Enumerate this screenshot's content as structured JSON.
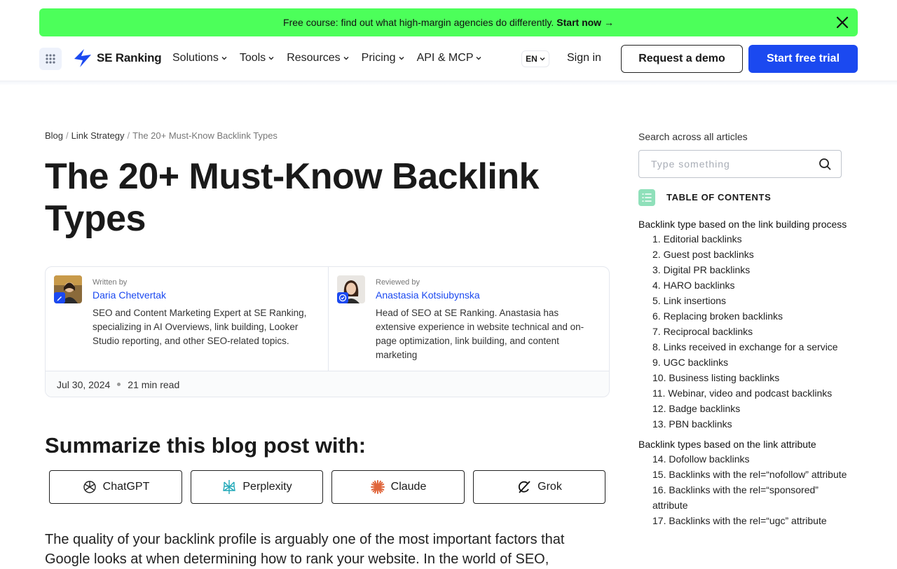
{
  "banner": {
    "text": "Free course: find out what high-margin agencies do differently.",
    "cta": "Start now →"
  },
  "nav": {
    "logo": "SE Ranking",
    "menu": [
      "Solutions",
      "Tools",
      "Resources",
      "Pricing",
      "API & MCP"
    ],
    "lang": "EN",
    "signin": "Sign in",
    "demo": "Request a demo",
    "trial": "Start free trial"
  },
  "breadcrumb": {
    "items": [
      "Blog",
      "Link Strategy"
    ],
    "current": "The 20+ Must-Know Backlink Types"
  },
  "title": "The 20+ Must-Know Backlink Types",
  "authors": [
    {
      "role": "Written by",
      "name": "Daria Chetvertak",
      "bio": "SEO and Content Marketing Expert at SE Ranking, specializing in AI Overviews, link building, Looker Studio reporting, and other SEO-related topics."
    },
    {
      "role": "Reviewed by",
      "name": "Anastasia Kotsiubynska",
      "bio": "Head of SEO at SE Ranking. Anastasia has extensive experience in website technical and on-page optimization, link building, and content marketing"
    }
  ],
  "meta": {
    "date": "Jul 30, 2024",
    "read": "21 min read"
  },
  "summarize": {
    "heading": "Summarize this blog post with:",
    "buttons": [
      "ChatGPT",
      "Perplexity",
      "Claude",
      "Grok"
    ]
  },
  "intro": "The quality of your backlink profile is arguably one of the most important factors that Google looks at when determining how to rank your website. In the world of SEO,",
  "sidebar": {
    "search_label": "Search across all articles",
    "search_placeholder": "Type something",
    "toc_title": "TABLE OF CONTENTS",
    "sections": [
      {
        "title": "Backlink type based on the link building process",
        "items": [
          "1. Editorial backlinks",
          "2. Guest post backlinks",
          "3. Digital PR backlinks",
          "4. HARO backlinks",
          "5. Link insertions",
          "6. Replacing broken backlinks",
          "7. Reciprocal backlinks",
          "8.  Links received in exchange for a service",
          "9. UGC backlinks",
          "10. Business listing backlinks",
          "11. Webinar, video and podcast backlinks",
          "12. Badge backlinks",
          "13. PBN backlinks"
        ]
      },
      {
        "title": "Backlink types based on the link attribute",
        "items": [
          "14. Dofollow backlinks",
          "15. Backlinks with the rel=“nofollow” attribute",
          "16. Backlinks with the rel=“sponsored” attribute",
          "17. Backlinks with the rel=“ugc” attribute"
        ]
      }
    ]
  },
  "colors": {
    "accent": "#1b49f0",
    "banner": "#4cff5a",
    "toc_icon": "#8fe0ba"
  }
}
